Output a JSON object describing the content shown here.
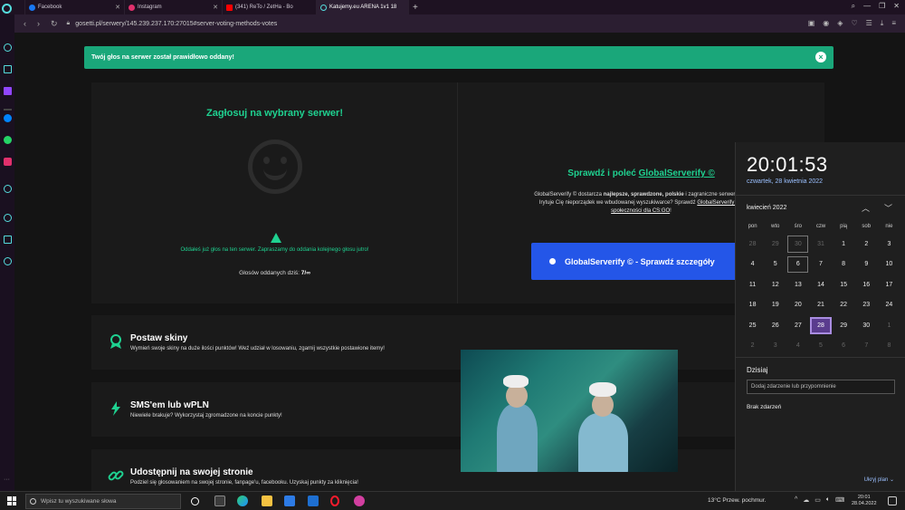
{
  "tabs": [
    {
      "label": "Facebook",
      "color": "#1877f2"
    },
    {
      "label": "Instagram",
      "color": "#e1306c"
    },
    {
      "label": "(341) ReTo / ZetHa - Bo",
      "color": "#ff0000"
    },
    {
      "label": "Katujemy.eu ARENA 1v1 18",
      "color": "#5dd"
    }
  ],
  "new_tab": "+",
  "address": {
    "url": "gosetti.pl/serwery/145.239.237.170:27015#server-voting-methods-votes"
  },
  "alert": {
    "text": "Twój głos na serwer został prawidłowo oddany!",
    "close": "×"
  },
  "vote": {
    "title": "Zagłosuj na wybrany serwer!",
    "warning": "Oddałeś już głos na ten serwer. Zapraszamy do oddania kolejnego głosu jutro!",
    "count_label": "Głosów oddanych dziś:",
    "count_value": "7/∞"
  },
  "gs": {
    "title_prefix": "Sprawdź i poleć",
    "title_link": "GlobalServerify ©",
    "desc_1": "GlobalServerify © dostarcza",
    "desc_bold": "najlepsze, sprawdzone, polskie",
    "desc_2": "i zagraniczne serwery bez",
    "desc_3": "Irytuje Cię nieporządek we wbudowanej wyszukiwarce? Sprawdź",
    "desc_link": "GlobalServerify © -",
    "desc_link2": "społeczności dla CS:GO",
    "desc_end": "!",
    "button": "GlobalServerify © - Sprawdź szczegóły"
  },
  "features": [
    {
      "title": "Postaw skiny",
      "desc": "Wymień swoje skiny na duże ilości punktów! Weź udział w losowaniu, zgarnij wszystkie postawione itemy!"
    },
    {
      "title": "SMS'em lub wPLN",
      "desc": "Niewiele brakuje? Wykorzystaj zgromadzone na koncie punkty!"
    },
    {
      "title": "Udostępnij na swojej stronie",
      "desc": "Podziel się głosowaniem na swojej stronie, fanpage'u, facebooku. Uzyskaj punkty za kliknięcia!"
    }
  ],
  "calendar": {
    "time": "20:01:53",
    "date": "czwartek, 28 kwietnia 2022",
    "month": "kwiecień 2022",
    "weekdays": [
      "pon",
      "wto",
      "śro",
      "czw",
      "pią",
      "sob",
      "nie"
    ],
    "days": [
      {
        "d": "28",
        "dim": true
      },
      {
        "d": "29",
        "dim": true
      },
      {
        "d": "30",
        "dim": true,
        "boxed": true
      },
      {
        "d": "31",
        "dim": true
      },
      {
        "d": "1"
      },
      {
        "d": "2"
      },
      {
        "d": "3"
      },
      {
        "d": "4"
      },
      {
        "d": "5"
      },
      {
        "d": "6",
        "boxed": true
      },
      {
        "d": "7"
      },
      {
        "d": "8"
      },
      {
        "d": "9"
      },
      {
        "d": "10"
      },
      {
        "d": "11"
      },
      {
        "d": "12"
      },
      {
        "d": "13"
      },
      {
        "d": "14"
      },
      {
        "d": "15"
      },
      {
        "d": "16"
      },
      {
        "d": "17"
      },
      {
        "d": "18"
      },
      {
        "d": "19"
      },
      {
        "d": "20"
      },
      {
        "d": "21"
      },
      {
        "d": "22"
      },
      {
        "d": "23"
      },
      {
        "d": "24"
      },
      {
        "d": "25"
      },
      {
        "d": "26"
      },
      {
        "d": "27"
      },
      {
        "d": "28",
        "today": true
      },
      {
        "d": "29"
      },
      {
        "d": "30"
      },
      {
        "d": "1",
        "dim": true
      },
      {
        "d": "2",
        "dim": true
      },
      {
        "d": "3",
        "dim": true
      },
      {
        "d": "4",
        "dim": true
      },
      {
        "d": "5",
        "dim": true
      },
      {
        "d": "6",
        "dim": true
      },
      {
        "d": "7",
        "dim": true
      },
      {
        "d": "8",
        "dim": true
      }
    ],
    "today_label": "Dzisiaj",
    "event_placeholder": "Dodaj zdarzenie lub przypomnienie",
    "no_events": "Brak zdarzeń",
    "hide": "Ukryj plan ⌄"
  },
  "taskbar": {
    "search_placeholder": "Wpisz tu wyszukiwane słowa",
    "weather": "13°C  Przew. pochmur.",
    "clock_time": "20:01",
    "clock_date": "28.04.2022"
  }
}
